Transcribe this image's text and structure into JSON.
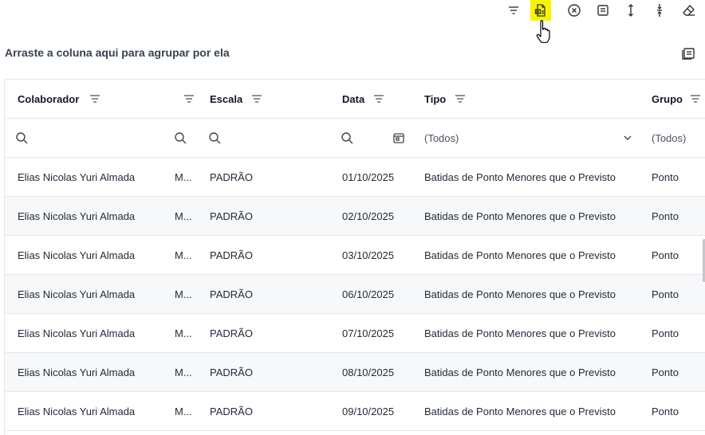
{
  "toolbar": {
    "buttons": [
      "filter-icon",
      "export-excel-icon",
      "clear-circle-icon",
      "notes-icon",
      "expand-vertical-icon",
      "collapse-vertical-icon",
      "eraser-icon"
    ]
  },
  "group_panel": {
    "hint": "Arraste a coluna aqui para agrupar por ela"
  },
  "columns": {
    "colaborador": "Colaborador",
    "escala": "Escala",
    "data": "Data",
    "tipo": "Tipo",
    "grupo": "Grupo"
  },
  "filters": {
    "tipo": "(Todos)",
    "grupo": "(Todos)"
  },
  "rows": [
    {
      "colaborador": "Elias Nicolas Yuri Almada",
      "m": "M...",
      "escala": "PADRÃO",
      "data": "01/10/2025",
      "tipo": "Batidas de Ponto Menores que o Previsto",
      "grupo": "Ponto"
    },
    {
      "colaborador": "Elias Nicolas Yuri Almada",
      "m": "M...",
      "escala": "PADRÃO",
      "data": "02/10/2025",
      "tipo": "Batidas de Ponto Menores que o Previsto",
      "grupo": "Ponto"
    },
    {
      "colaborador": "Elias Nicolas Yuri Almada",
      "m": "M...",
      "escala": "PADRÃO",
      "data": "03/10/2025",
      "tipo": "Batidas de Ponto Menores que o Previsto",
      "grupo": "Ponto"
    },
    {
      "colaborador": "Elias Nicolas Yuri Almada",
      "m": "M...",
      "escala": "PADRÃO",
      "data": "06/10/2025",
      "tipo": "Batidas de Ponto Menores que o Previsto",
      "grupo": "Ponto"
    },
    {
      "colaborador": "Elias Nicolas Yuri Almada",
      "m": "M...",
      "escala": "PADRÃO",
      "data": "07/10/2025",
      "tipo": "Batidas de Ponto Menores que o Previsto",
      "grupo": "Ponto"
    },
    {
      "colaborador": "Elias Nicolas Yuri Almada",
      "m": "M...",
      "escala": "PADRÃO",
      "data": "08/10/2025",
      "tipo": "Batidas de Ponto Menores que o Previsto",
      "grupo": "Ponto"
    },
    {
      "colaborador": "Elias Nicolas Yuri Almada",
      "m": "M...",
      "escala": "PADRÃO",
      "data": "09/10/2025",
      "tipo": "Batidas de Ponto Menores que o Previsto",
      "grupo": "Ponto"
    }
  ]
}
